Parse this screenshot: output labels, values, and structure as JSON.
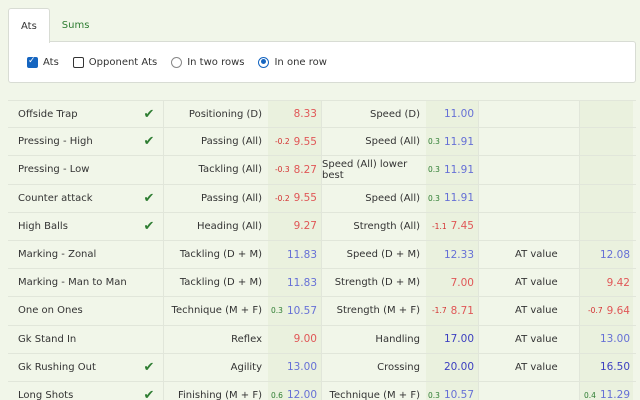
{
  "tabs": [
    {
      "label": "Ats",
      "active": true
    },
    {
      "label": "Sums",
      "active": false
    }
  ],
  "options": {
    "ats": {
      "label": "Ats",
      "checked": true
    },
    "opponent_ats": {
      "label": "Opponent Ats",
      "checked": false
    },
    "two_rows": {
      "label": "In two rows",
      "checked": false
    },
    "one_row": {
      "label": "In one row",
      "checked": true
    }
  },
  "rows": [
    {
      "name": "Offside Trap",
      "check": "✔",
      "l1": "Positioning (D)",
      "d1": "",
      "v1": "8.33",
      "c1": "red",
      "l2": "Speed (D)",
      "d2": "",
      "v2": "11.00",
      "c2": "blue",
      "l3": "",
      "d3": "",
      "v3": "",
      "c3": ""
    },
    {
      "name": "Pressing - High",
      "check": "✔",
      "l1": "Passing (All)",
      "d1": "-0.2",
      "v1": "9.55",
      "c1": "red",
      "l2": "Speed (All)",
      "d2": "0.3",
      "v2": "11.91",
      "c2": "blue",
      "l3": "",
      "d3": "",
      "v3": "",
      "c3": ""
    },
    {
      "name": "Pressing - Low",
      "check": "",
      "l1": "Tackling (All)",
      "d1": "-0.3",
      "v1": "8.27",
      "c1": "red",
      "l2": "Speed (All) lower best",
      "d2": "0.3",
      "v2": "11.91",
      "c2": "blue",
      "l3": "",
      "d3": "",
      "v3": "",
      "c3": ""
    },
    {
      "name": "Counter attack",
      "check": "✔",
      "l1": "Passing (All)",
      "d1": "-0.2",
      "v1": "9.55",
      "c1": "red",
      "l2": "Speed (All)",
      "d2": "0.3",
      "v2": "11.91",
      "c2": "blue",
      "l3": "",
      "d3": "",
      "v3": "",
      "c3": ""
    },
    {
      "name": "High Balls",
      "check": "✔",
      "l1": "Heading (All)",
      "d1": "",
      "v1": "9.27",
      "c1": "red",
      "l2": "Strength (All)",
      "d2": "-1.1",
      "v2": "7.45",
      "c2": "red",
      "l3": "",
      "d3": "",
      "v3": "",
      "c3": ""
    },
    {
      "name": "Marking - Zonal",
      "check": "",
      "l1": "Tackling (D + M)",
      "d1": "",
      "v1": "11.83",
      "c1": "blue",
      "l2": "Speed (D + M)",
      "d2": "",
      "v2": "12.33",
      "c2": "blue",
      "l3": "AT value",
      "d3": "",
      "v3": "12.08",
      "c3": "blue"
    },
    {
      "name": "Marking - Man to Man",
      "check": "",
      "l1": "Tackling (D + M)",
      "d1": "",
      "v1": "11.83",
      "c1": "blue",
      "l2": "Strength (D + M)",
      "d2": "",
      "v2": "7.00",
      "c2": "red",
      "l3": "AT value",
      "d3": "",
      "v3": "9.42",
      "c3": "red"
    },
    {
      "name": "One on Ones",
      "check": "",
      "l1": "Technique (M + F)",
      "d1": "0.3",
      "v1": "10.57",
      "c1": "blue",
      "l2": "Strength (M + F)",
      "d2": "-1.7",
      "v2": "8.71",
      "c2": "red",
      "l3": "AT value",
      "d3": "-0.7",
      "v3": "9.64",
      "c3": "red"
    },
    {
      "name": "Gk Stand In",
      "check": "",
      "l1": "Reflex",
      "d1": "",
      "v1": "9.00",
      "c1": "red",
      "l2": "Handling",
      "d2": "",
      "v2": "17.00",
      "c2": "navy",
      "l3": "AT value",
      "d3": "",
      "v3": "13.00",
      "c3": "blue"
    },
    {
      "name": "Gk Rushing Out",
      "check": "✔",
      "l1": "Agility",
      "d1": "",
      "v1": "13.00",
      "c1": "blue",
      "l2": "Crossing",
      "d2": "",
      "v2": "20.00",
      "c2": "navy",
      "l3": "AT value",
      "d3": "",
      "v3": "16.50",
      "c3": "navy"
    },
    {
      "name": "Long Shots",
      "check": "✔",
      "l1": "Finishing (M + F)",
      "d1": "0.6",
      "v1": "12.00",
      "c1": "blue",
      "l2": "Technique (M + F)",
      "d2": "0.3",
      "v2": "10.57",
      "c2": "blue",
      "l3": "",
      "d3": "0.4",
      "v3": "11.29",
      "c3": "blue"
    }
  ],
  "colors": {
    "red": "#e05757",
    "blue": "#6670d6",
    "navy": "#3c3fc0",
    "green": "#2e7d32"
  }
}
